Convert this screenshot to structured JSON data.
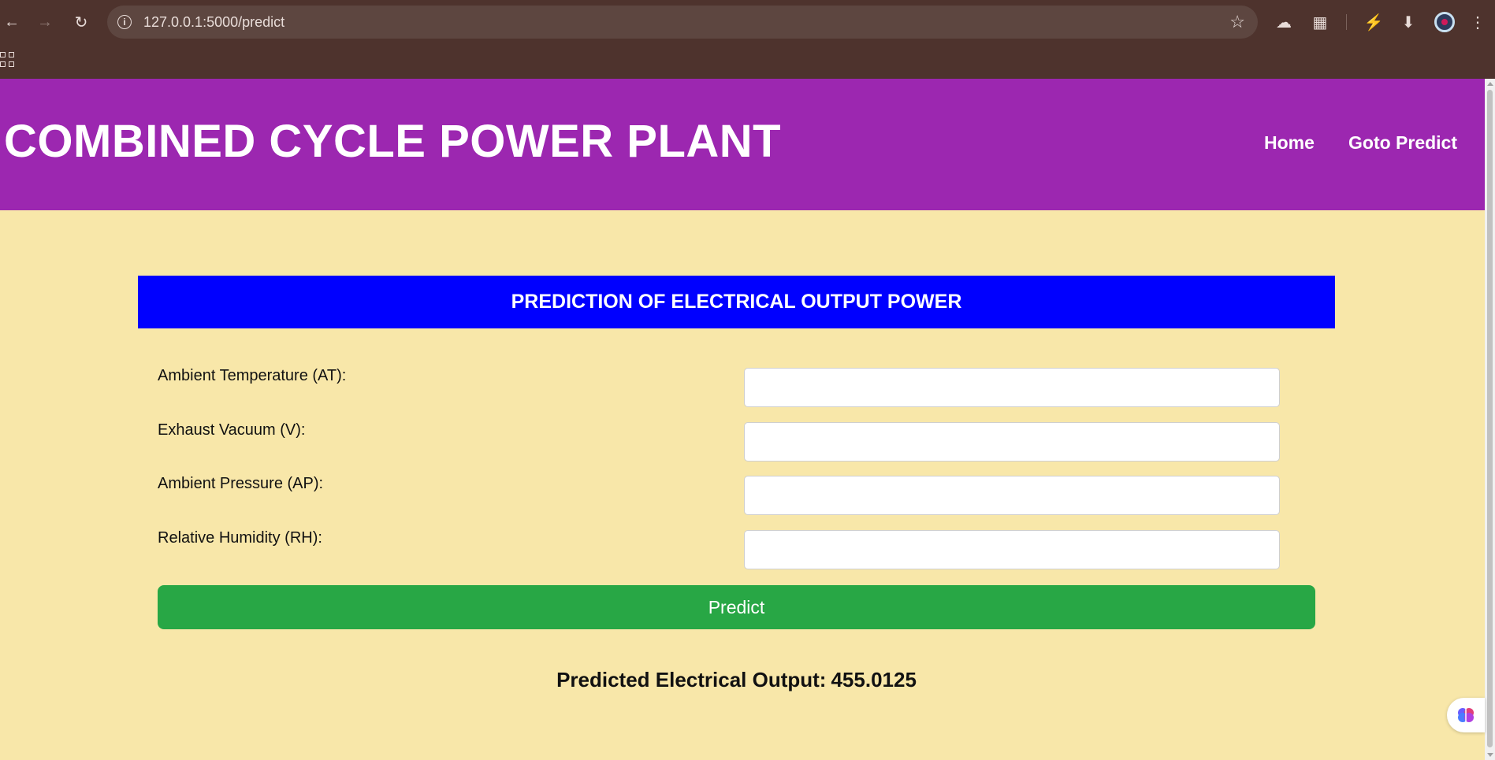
{
  "browser": {
    "url": "127.0.0.1:5000/predict",
    "icons": {
      "back": "arrow-left-icon",
      "forward": "arrow-right-icon",
      "reload": "reload-icon",
      "site_info": "info-icon",
      "bookmark": "star-icon",
      "extensions_shape": "cloud-icon",
      "extensions": "puzzle-icon",
      "performance": "speed-icon",
      "downloads": "download-icon",
      "menu": "kebab-menu-icon",
      "apps": "apps-grid-icon"
    },
    "colors": {
      "frame": "#4e332d",
      "omnibox": "#5d4640"
    }
  },
  "header": {
    "title": "COMBINED CYCLE POWER PLANT",
    "nav": [
      "Home",
      "Goto Predict"
    ],
    "color": "#9c27b0"
  },
  "form": {
    "banner": "PREDICTION OF ELECTRICAL OUTPUT POWER",
    "banner_color": "#0000ff",
    "fields": [
      {
        "label": "Ambient Temperature (AT):",
        "value": ""
      },
      {
        "label": "Exhaust Vacuum (V):",
        "value": ""
      },
      {
        "label": "Ambient Pressure (AP):",
        "value": ""
      },
      {
        "label": "Relative Humidity (RH):",
        "value": ""
      }
    ],
    "submit_label": "Predict",
    "submit_color": "#28a745"
  },
  "result": {
    "label": "Predicted Electrical Output:",
    "value": "455.0125"
  },
  "page_background": "#f8e7a9"
}
